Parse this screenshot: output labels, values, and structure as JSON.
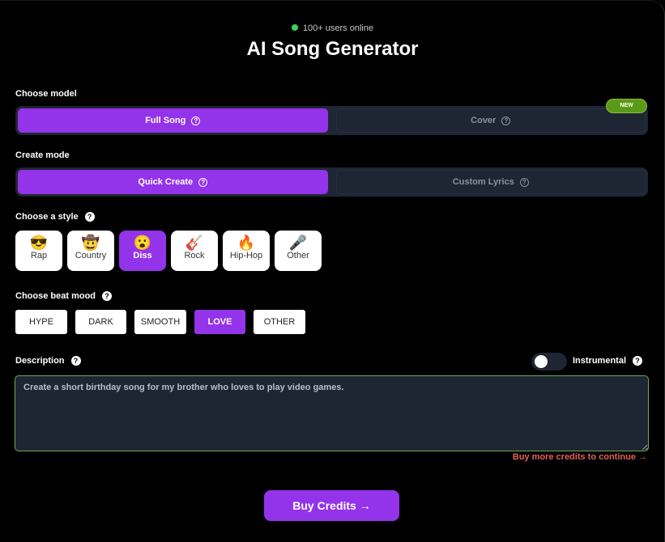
{
  "header": {
    "online": "100+ users online",
    "title": "AI Song Generator"
  },
  "model": {
    "label": "Choose model",
    "options": [
      "Full Song",
      "Cover"
    ],
    "selected": "Full Song",
    "new_badge": "NEW"
  },
  "mode": {
    "label": "Create mode",
    "options": [
      "Quick Create",
      "Custom Lyrics"
    ],
    "selected": "Quick Create"
  },
  "style": {
    "label": "Choose a style",
    "options": [
      {
        "label": "Rap",
        "icon": "😎"
      },
      {
        "label": "Country",
        "icon": "🤠"
      },
      {
        "label": "Diss",
        "icon": "😮"
      },
      {
        "label": "Rock",
        "icon": "🎸"
      },
      {
        "label": "Hip-Hop",
        "icon": "🔥"
      },
      {
        "label": "Other",
        "icon": "🎤"
      }
    ],
    "selected": "Diss"
  },
  "mood": {
    "label": "Choose beat mood",
    "options": [
      "HYPE",
      "DARK",
      "SMOOTH",
      "LOVE",
      "OTHER"
    ],
    "selected": "LOVE"
  },
  "description": {
    "label": "Description",
    "value": "Create a short birthday song for my brother who loves to play video games.",
    "instrumental_label": "Instrumental",
    "instrumental_on": false
  },
  "credits": {
    "warning": "Buy more credits to continue →",
    "buy_label": "Buy Credits →"
  },
  "colors": {
    "accent": "#9333ea",
    "online": "#3ecf5c",
    "warning": "#e0605a",
    "new_badge": "#5a9a16"
  }
}
